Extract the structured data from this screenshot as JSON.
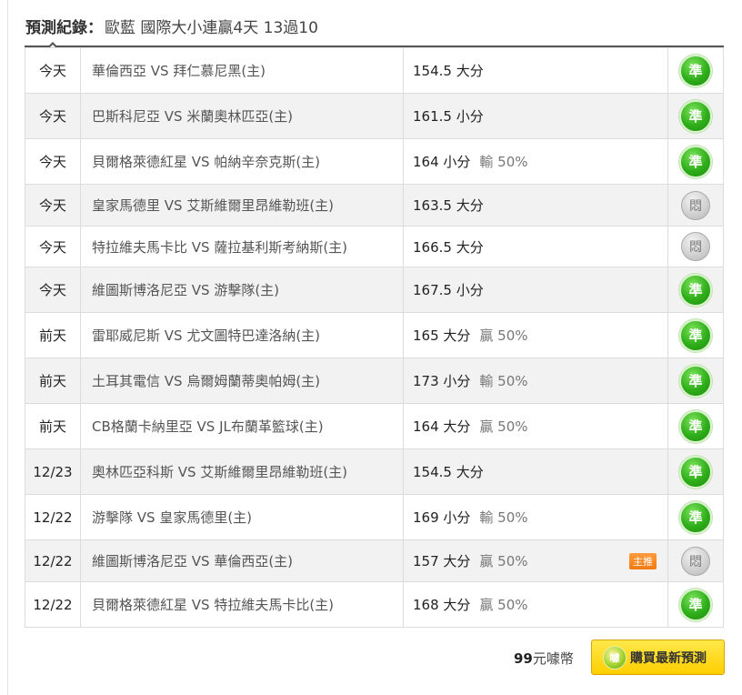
{
  "header": {
    "label": "預測紀錄：",
    "text": "歐藍 國際大小連贏4天 13過10"
  },
  "rows": [
    {
      "date": "今天",
      "match": "華倫西亞 VS 拜仁慕尼黑(主)",
      "prediction": "154.5 大分",
      "percent": "",
      "tag": "",
      "result": "準",
      "status": "hit"
    },
    {
      "date": "今天",
      "match": "巴斯科尼亞 VS 米蘭奧林匹亞(主)",
      "prediction": "161.5 小分",
      "percent": "",
      "tag": "",
      "result": "準",
      "status": "hit"
    },
    {
      "date": "今天",
      "match": "貝爾格萊德紅星 VS 帕納辛奈克斯(主)",
      "prediction": "164 小分",
      "percent": "輸 50%",
      "tag": "",
      "result": "準",
      "status": "hit"
    },
    {
      "date": "今天",
      "match": "皇家馬德里 VS 艾斯維爾里昂維勒班(主)",
      "prediction": "163.5 大分",
      "percent": "",
      "tag": "",
      "result": "悶",
      "status": "miss"
    },
    {
      "date": "今天",
      "match": "特拉維夫馬卡比 VS 薩拉基利斯考納斯(主)",
      "prediction": "166.5 大分",
      "percent": "",
      "tag": "",
      "result": "悶",
      "status": "miss"
    },
    {
      "date": "今天",
      "match": "維圖斯博洛尼亞 VS 游擊隊(主)",
      "prediction": "167.5 小分",
      "percent": "",
      "tag": "",
      "result": "準",
      "status": "hit"
    },
    {
      "date": "前天",
      "match": "雷耶威尼斯 VS 尤文圖特巴達洛納(主)",
      "prediction": "165 大分",
      "percent": "贏 50%",
      "tag": "",
      "result": "準",
      "status": "hit"
    },
    {
      "date": "前天",
      "match": "土耳其電信 VS 烏爾姆蘭蒂奧帕姆(主)",
      "prediction": "173 小分",
      "percent": "輸 50%",
      "tag": "",
      "result": "準",
      "status": "hit"
    },
    {
      "date": "前天",
      "match": "CB格蘭卡納里亞 VS JL布蘭革籃球(主)",
      "prediction": "164 大分",
      "percent": "贏 50%",
      "tag": "",
      "result": "準",
      "status": "hit"
    },
    {
      "date": "12/23",
      "match": "奧林匹亞科斯 VS 艾斯維爾里昂維勒班(主)",
      "prediction": "154.5 大分",
      "percent": "",
      "tag": "",
      "result": "準",
      "status": "hit"
    },
    {
      "date": "12/22",
      "match": "游擊隊 VS 皇家馬德里(主)",
      "prediction": "169 小分",
      "percent": "輸 50%",
      "tag": "",
      "result": "準",
      "status": "hit"
    },
    {
      "date": "12/22",
      "match": "維圖斯博洛尼亞 VS 華倫西亞(主)",
      "prediction": "157 大分",
      "percent": "贏 50%",
      "tag": "主推",
      "result": "悶",
      "status": "miss"
    },
    {
      "date": "12/22",
      "match": "貝爾格萊德紅星 VS 特拉維夫馬卡比(主)",
      "prediction": "168 大分",
      "percent": "贏 50%",
      "tag": "",
      "result": "準",
      "status": "hit"
    }
  ],
  "footer": {
    "price_amount": "99",
    "price_unit": "元噱幣",
    "buy_icon_text": "噱",
    "buy_label": "購買最新預測"
  },
  "colors": {
    "hit": "#2fae1a",
    "miss": "#cfcfcf",
    "push_tag": "#f27a12",
    "buy_button": "#ffd400"
  }
}
